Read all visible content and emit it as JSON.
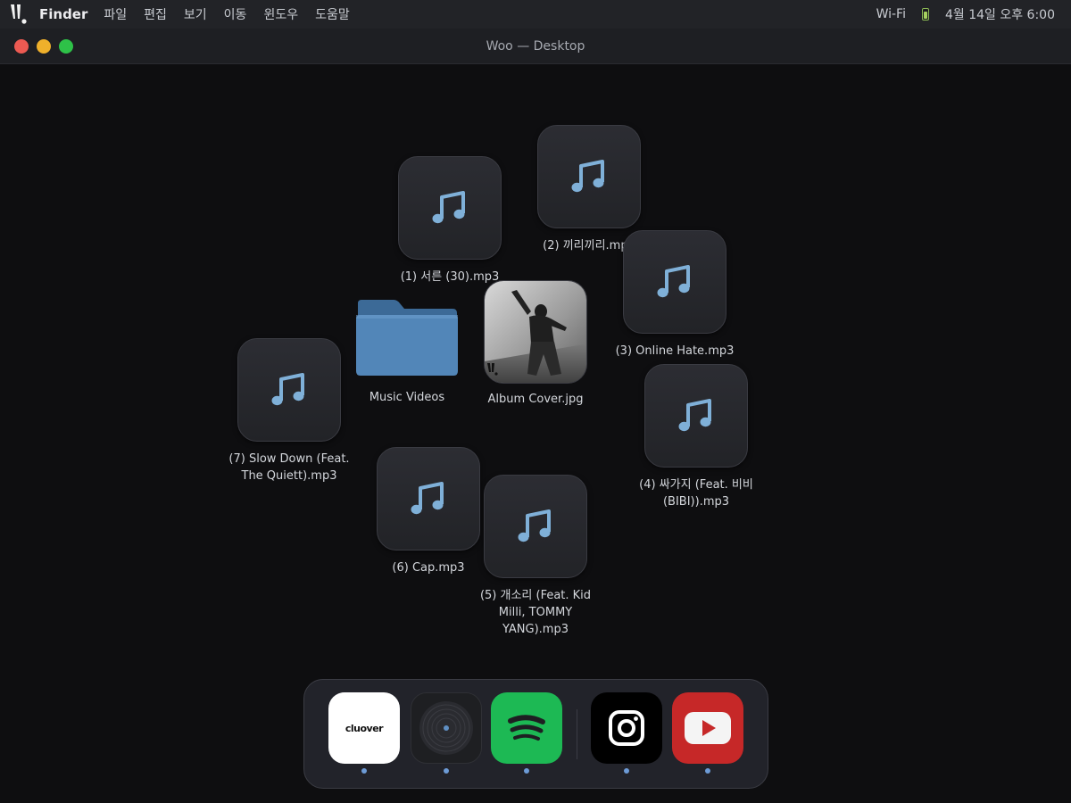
{
  "menubar": {
    "logo_icon": "artist-logo-icon",
    "app_name": "Finder",
    "menus": [
      "파일",
      "편집",
      "보기",
      "이동",
      "윈도우",
      "도움말"
    ],
    "wifi": "Wi-Fi",
    "battery_icon": "battery-icon",
    "datetime": "4월 14일 오후 6:00"
  },
  "window": {
    "title": "Woo — Desktop",
    "controls": [
      "close",
      "minimize",
      "zoom"
    ]
  },
  "desktop": {
    "files": [
      {
        "name": "(1) 서른 (30).mp3",
        "icon": "music-note-icon"
      },
      {
        "name": "(2) 끼리끼리.mp3",
        "icon": "music-note-icon"
      },
      {
        "name": "(3) Online Hate.mp3",
        "icon": "music-note-icon"
      },
      {
        "name": "(4) 싸가지 (Feat. 비비 (BIBI)).mp3",
        "icon": "music-note-icon"
      },
      {
        "name": "(5) 개소리 (Feat. Kid Milli, TOMMY YANG).mp3",
        "icon": "music-note-icon"
      },
      {
        "name": "(6) Cap.mp3",
        "icon": "music-note-icon"
      },
      {
        "name": "(7) Slow Down (Feat. The Quiett).mp3",
        "icon": "music-note-icon"
      }
    ],
    "folder": {
      "name": "Music Videos",
      "icon": "folder-icon"
    },
    "image": {
      "name": "Album Cover.jpg",
      "icon": "album-cover-thumbnail"
    }
  },
  "dock": {
    "apps": [
      {
        "name": "Cluover",
        "label": "cluover",
        "icon": "cluover-icon",
        "running": true
      },
      {
        "name": "Vinyl Player",
        "icon": "vinyl-record-icon",
        "running": true
      },
      {
        "name": "Spotify",
        "icon": "spotify-icon",
        "running": true
      },
      {
        "name": "Instagram",
        "icon": "instagram-icon",
        "running": true
      },
      {
        "name": "YouTube",
        "icon": "youtube-icon",
        "running": true
      }
    ]
  },
  "colors": {
    "background": "#0e0e10",
    "accent_note": "#7fb0d8",
    "folder_blue": "#4f82b4",
    "spotify_green": "#1db954",
    "youtube_red": "#c62828"
  }
}
